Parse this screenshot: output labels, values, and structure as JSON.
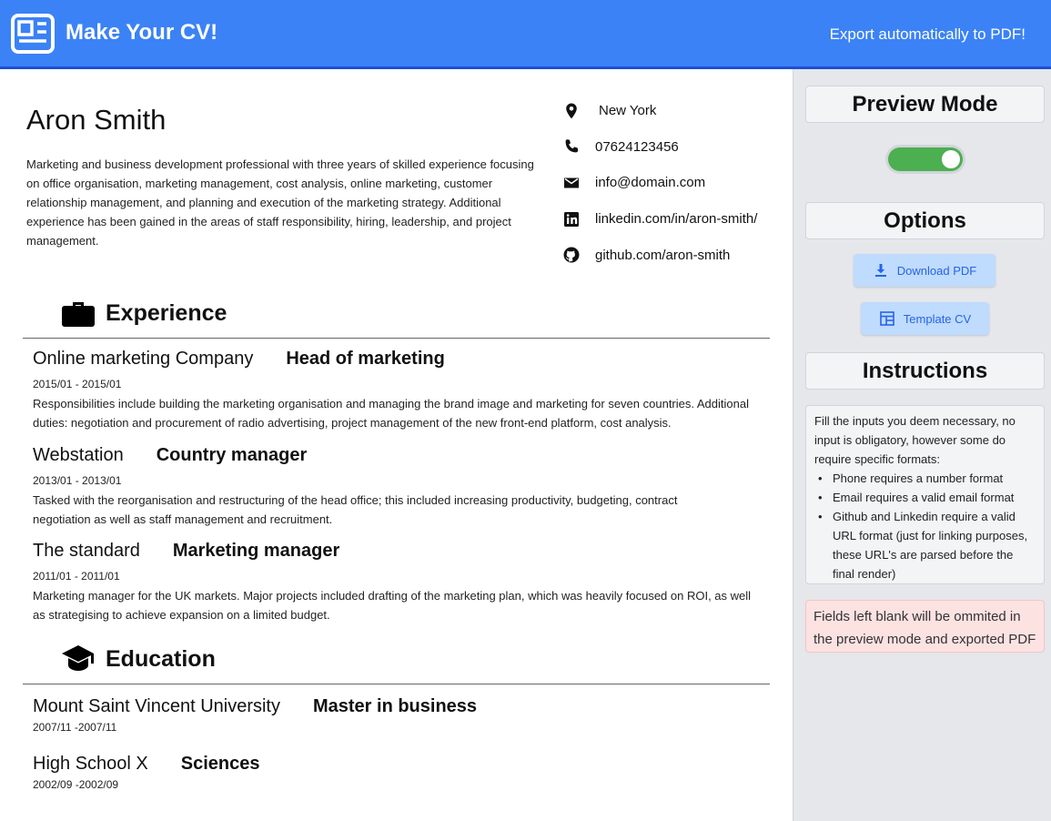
{
  "header": {
    "app_title": "Make Your CV!",
    "export_text": "Export automatically to PDF!",
    "logo_icon": "newspaper-icon"
  },
  "cv": {
    "name": "Aron Smith",
    "summary": "Marketing and business development professional with three years of skilled experience focusing on office organisation, marketing management, cost analysis, online marketing, customer relationship management, and planning and execution of the marketing strategy. Additional experience has been gained in the areas of staff responsibility, hiring, leadership, and project management.",
    "contacts": {
      "location": {
        "icon": "location-pin-icon",
        "text": "New York"
      },
      "phone": {
        "icon": "phone-icon",
        "text": "07624123456"
      },
      "email": {
        "icon": "envelope-icon",
        "text": "info@domain.com"
      },
      "linkedin": {
        "icon": "linkedin-icon",
        "text": "linkedin.com/in/aron-smith/"
      },
      "github": {
        "icon": "github-icon",
        "text": "github.com/aron-smith"
      }
    },
    "experience": {
      "title": "Experience",
      "icon": "briefcase-icon",
      "items": [
        {
          "org": "Online marketing Company",
          "role": "Head of marketing",
          "date": "2015/01 - 2015/01",
          "desc": "Responsibilities include building the marketing organisation and managing the brand image and marketing for seven countries. Additional duties: negotiation and procurement of radio advertising, project management of the new front-end platform, cost analysis."
        },
        {
          "org": "Webstation",
          "role": "Country manager",
          "date": "2013/01 - 2013/01",
          "desc": "Tasked with the reorganisation and restructuring of the head office; this included increasing productivity, budgeting, contract negotiation as well as staff management and recruitment."
        },
        {
          "org": "The standard",
          "role": "Marketing manager",
          "date": "2011/01 - 2011/01",
          "desc": "Marketing manager for the UK markets. Major projects included drafting of the marketing plan, which was heavily focused on ROI, as well as strategising to achieve expansion on a limited budget."
        }
      ]
    },
    "education": {
      "title": "Education",
      "icon": "graduation-cap-icon",
      "items": [
        {
          "org": "Mount Saint Vincent University",
          "role": "Master in business",
          "date": "2007/11 -2007/11"
        },
        {
          "org": "High School X",
          "role": "Sciences",
          "date": "2002/09 -2002/09"
        }
      ]
    }
  },
  "sidebar": {
    "preview_title": "Preview Mode",
    "preview_toggle_on": true,
    "options_title": "Options",
    "download_label": "Download PDF",
    "download_icon": "download-icon",
    "template_label": "Template CV",
    "template_icon": "template-icon",
    "instructions_title": "Instructions",
    "instructions_intro": "Fill the inputs you deem necessary, no input is obligatory, however some do require specific formats:",
    "instructions_items": [
      "Phone requires a number format",
      "Email requires a valid email format",
      "Github and Linkedin require a valid URL format (just for linking purposes, these URL's are parsed before the final render)"
    ],
    "warning_text": "Fields left blank will be ommited in the preview mode and exported PDF"
  },
  "colors": {
    "header_bg": "#3b82f6",
    "sidebar_bg": "#e5e7eb",
    "toggle_on": "#4caf50",
    "button_bg": "#bfdbfe",
    "button_text": "#2563eb",
    "warning_bg": "#fde2e2"
  }
}
